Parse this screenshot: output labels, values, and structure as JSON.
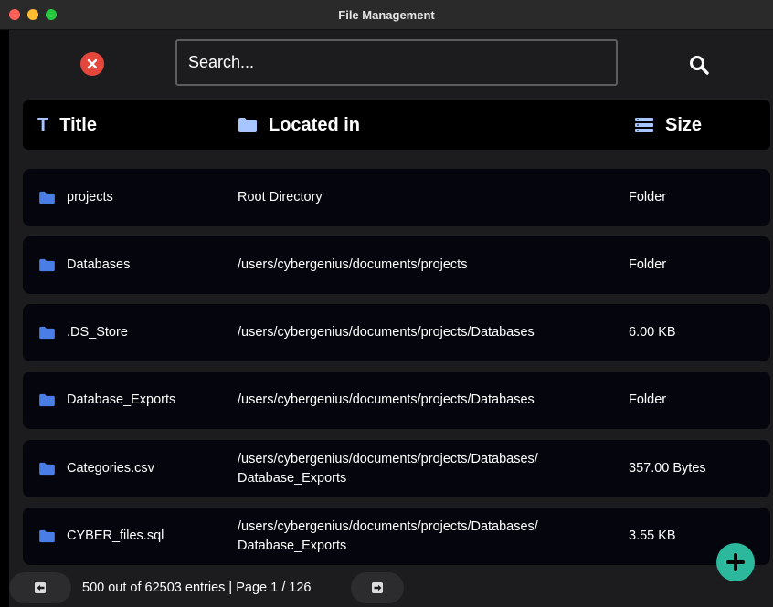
{
  "window": {
    "title": "File Management"
  },
  "search": {
    "placeholder": "Search...",
    "value": ""
  },
  "header": {
    "title": "Title",
    "location": "Located in",
    "size": "Size"
  },
  "rows": [
    {
      "name": "projects",
      "path_line1": "Root Directory",
      "path_line2": "",
      "size": "Folder"
    },
    {
      "name": "Databases",
      "path_line1": "/users/cybergenius/documents/projects",
      "path_line2": "",
      "size": "Folder"
    },
    {
      "name": ".DS_Store",
      "path_line1": "/users/cybergenius/documents/projects/Databases",
      "path_line2": "",
      "size": "6.00 KB"
    },
    {
      "name": "Database_Exports",
      "path_line1": "/users/cybergenius/documents/projects/Databases",
      "path_line2": "",
      "size": "Folder"
    },
    {
      "name": "Categories.csv",
      "path_line1": "/users/cybergenius/documents/projects/Databases/",
      "path_line2": "Database_Exports",
      "size": "357.00 Bytes"
    },
    {
      "name": "CYBER_files.sql",
      "path_line1": "/users/cybergenius/documents/projects/Databases/",
      "path_line2": "Database_Exports",
      "size": "3.55 KB"
    }
  ],
  "pagination": {
    "status": "500 out of 62503 entries | Page 1 / 126"
  },
  "icons": {
    "clear": "close-circle-icon",
    "search": "magnifier-icon",
    "title_header": "text-t-icon",
    "location_header": "folder-icon",
    "size_header": "list-stack-icon",
    "row": "folder-icon",
    "add": "plus-icon",
    "prev": "left-arrow-icon",
    "next": "right-arrow-icon"
  },
  "colors": {
    "accent_blue": "#a7c6ff",
    "folder_blue": "#4a7ee6",
    "clear_red": "#e5463c",
    "add_green": "#2bb89d",
    "row_bg": "#05050d",
    "panel_bg": "#1c1c1e"
  }
}
